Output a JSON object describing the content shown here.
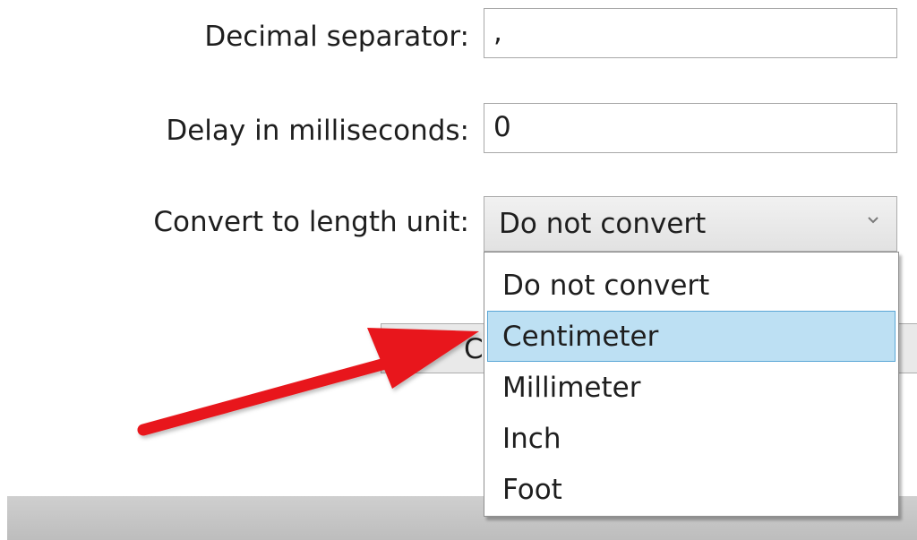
{
  "form": {
    "decimal_separator": {
      "label": "Decimal separator:",
      "value": ","
    },
    "delay": {
      "label": "Delay in milliseconds:",
      "value": "0"
    },
    "length_unit": {
      "label": "Convert to length unit:",
      "selected": "Do not convert",
      "chevron_icon": "chevron-down-icon",
      "options": [
        "Do not convert",
        "Centimeter",
        "Millimeter",
        "Inch",
        "Foot"
      ],
      "highlighted_option": "Centimeter"
    }
  },
  "partial_button": {
    "label": "C"
  },
  "annotation": {
    "icon": "red-arrow-annotation",
    "color": "#e8181b"
  }
}
